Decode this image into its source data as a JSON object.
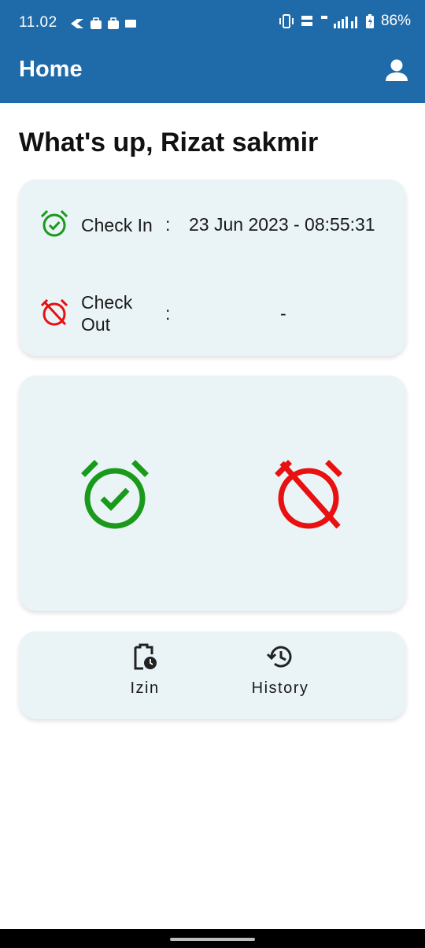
{
  "status_bar": {
    "time": "11.02",
    "battery": "86%"
  },
  "app_bar": {
    "title": "Home",
    "profile_icon": "person-icon"
  },
  "greeting": "What's up, Rizat sakmir",
  "attendance": {
    "check_in": {
      "label": "Check In",
      "separator": ":",
      "value": "23 Jun 2023 - 08:55:31",
      "icon": "alarm-check-icon",
      "color": "#1a9a1a"
    },
    "check_out": {
      "label_line1": "Check",
      "label_line2": "Out",
      "separator": ":",
      "value": "-",
      "icon": "alarm-off-icon",
      "color": "#e81010"
    }
  },
  "actions": {
    "check_in_icon": "alarm-check-icon",
    "check_out_icon": "alarm-off-icon"
  },
  "menu": [
    {
      "label": "Izin",
      "icon": "clipboard-clock-icon"
    },
    {
      "label": "History",
      "icon": "history-icon"
    }
  ],
  "colors": {
    "app_bar": "#1f6aa8",
    "card_bg": "#eaf4f6",
    "check_in": "#1a9a1a",
    "check_out": "#e81010"
  }
}
